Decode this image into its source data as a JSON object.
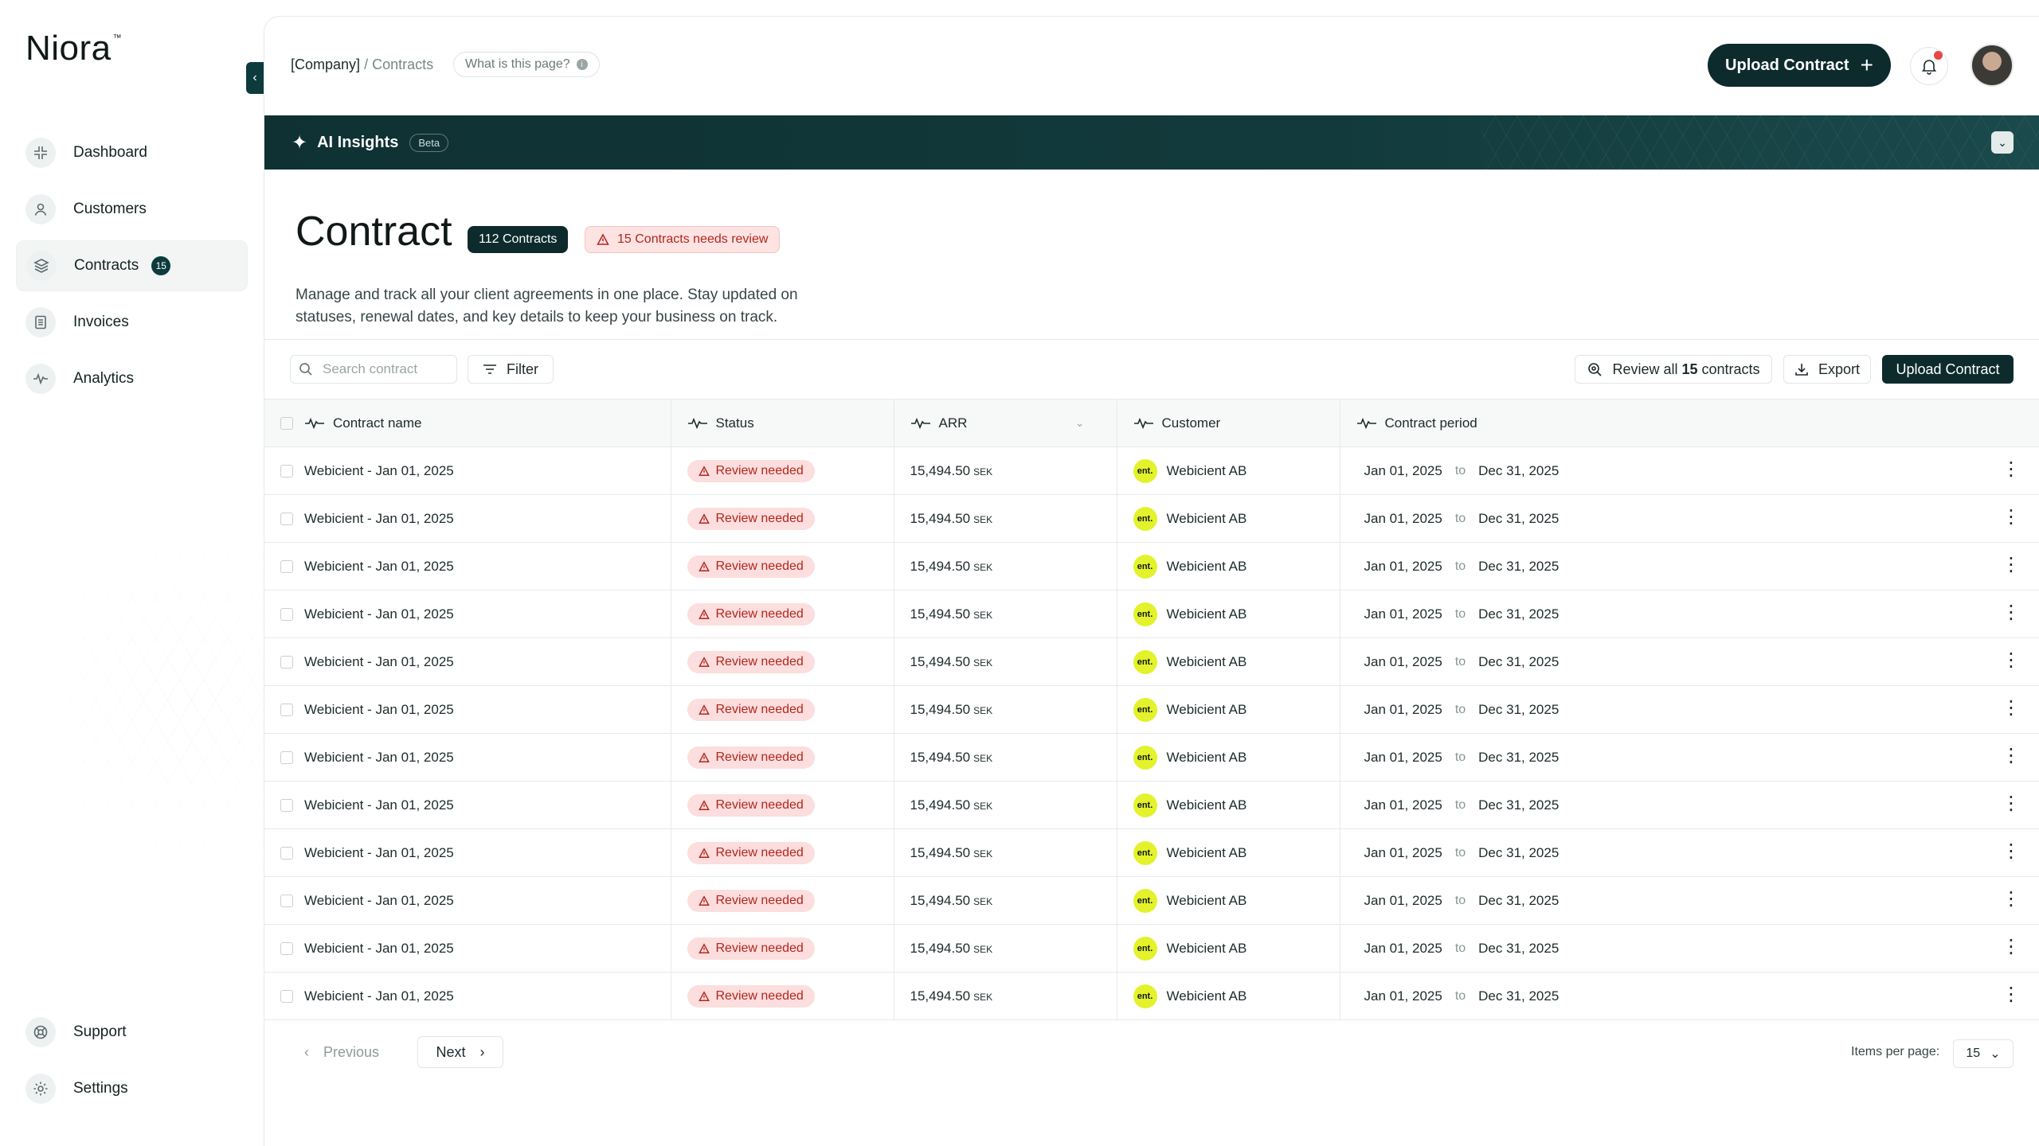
{
  "app": {
    "logo": "Niora",
    "trademark": "™"
  },
  "sidebar": {
    "items": [
      {
        "label": "Dashboard",
        "icon": "dashboard-icon"
      },
      {
        "label": "Customers",
        "icon": "user-icon"
      },
      {
        "label": "Contracts",
        "icon": "layers-icon",
        "badge": "15",
        "active": true
      },
      {
        "label": "Invoices",
        "icon": "document-icon"
      },
      {
        "label": "Analytics",
        "icon": "pulse-icon"
      }
    ],
    "bottom": [
      {
        "label": "Support",
        "icon": "lifebuoy-icon"
      },
      {
        "label": "Settings",
        "icon": "gear-icon"
      }
    ]
  },
  "header": {
    "breadcrumb_company": "[Company]",
    "breadcrumb_sep": "/",
    "breadcrumb_current": "Contracts",
    "help": "What is this page?",
    "help_icon": "i",
    "upload_button": "Upload Contract",
    "notification_color": "#e74848"
  },
  "ai_insights": {
    "title": "AI Insights",
    "beta": "Beta"
  },
  "page": {
    "title": "Contract",
    "count_chip": "112 Contracts",
    "review_chip": "15 Contracts needs review",
    "description": "Manage and track all your client agreements in one place. Stay updated on statuses, renewal dates, and key details to keep your business on track."
  },
  "toolbar": {
    "search_placeholder": "Search contract",
    "filter": "Filter",
    "review_all_prefix": "Review all ",
    "review_all_count": "15",
    "review_all_suffix": " contracts",
    "export": "Export",
    "upload": "Upload Contract"
  },
  "table": {
    "columns": {
      "name": "Contract name",
      "status": "Status",
      "arr": "ARR",
      "customer": "Customer",
      "period": "Contract period"
    },
    "rows": [
      {
        "name": "Webicient - Jan 01, 2025",
        "status": "Review needed",
        "arr": "15,494.50",
        "currency": "SEK",
        "logo": "ent.",
        "customer": "Webicient AB",
        "start": "Jan 01, 2025",
        "to": "to",
        "end": "Dec 31, 2025"
      },
      {
        "name": "Webicient - Jan 01, 2025",
        "status": "Review needed",
        "arr": "15,494.50",
        "currency": "SEK",
        "logo": "ent.",
        "customer": "Webicient AB",
        "start": "Jan 01, 2025",
        "to": "to",
        "end": "Dec 31, 2025"
      },
      {
        "name": "Webicient - Jan 01, 2025",
        "status": "Review needed",
        "arr": "15,494.50",
        "currency": "SEK",
        "logo": "ent.",
        "customer": "Webicient AB",
        "start": "Jan 01, 2025",
        "to": "to",
        "end": "Dec 31, 2025"
      },
      {
        "name": "Webicient - Jan 01, 2025",
        "status": "Review needed",
        "arr": "15,494.50",
        "currency": "SEK",
        "logo": "ent.",
        "customer": "Webicient AB",
        "start": "Jan 01, 2025",
        "to": "to",
        "end": "Dec 31, 2025"
      },
      {
        "name": "Webicient - Jan 01, 2025",
        "status": "Review needed",
        "arr": "15,494.50",
        "currency": "SEK",
        "logo": "ent.",
        "customer": "Webicient AB",
        "start": "Jan 01, 2025",
        "to": "to",
        "end": "Dec 31, 2025"
      },
      {
        "name": "Webicient - Jan 01, 2025",
        "status": "Review needed",
        "arr": "15,494.50",
        "currency": "SEK",
        "logo": "ent.",
        "customer": "Webicient AB",
        "start": "Jan 01, 2025",
        "to": "to",
        "end": "Dec 31, 2025"
      },
      {
        "name": "Webicient - Jan 01, 2025",
        "status": "Review needed",
        "arr": "15,494.50",
        "currency": "SEK",
        "logo": "ent.",
        "customer": "Webicient AB",
        "start": "Jan 01, 2025",
        "to": "to",
        "end": "Dec 31, 2025"
      },
      {
        "name": "Webicient - Jan 01, 2025",
        "status": "Review needed",
        "arr": "15,494.50",
        "currency": "SEK",
        "logo": "ent.",
        "customer": "Webicient AB",
        "start": "Jan 01, 2025",
        "to": "to",
        "end": "Dec 31, 2025"
      },
      {
        "name": "Webicient - Jan 01, 2025",
        "status": "Review needed",
        "arr": "15,494.50",
        "currency": "SEK",
        "logo": "ent.",
        "customer": "Webicient AB",
        "start": "Jan 01, 2025",
        "to": "to",
        "end": "Dec 31, 2025"
      },
      {
        "name": "Webicient - Jan 01, 2025",
        "status": "Review needed",
        "arr": "15,494.50",
        "currency": "SEK",
        "logo": "ent.",
        "customer": "Webicient AB",
        "start": "Jan 01, 2025",
        "to": "to",
        "end": "Dec 31, 2025"
      },
      {
        "name": "Webicient - Jan 01, 2025",
        "status": "Review needed",
        "arr": "15,494.50",
        "currency": "SEK",
        "logo": "ent.",
        "customer": "Webicient AB",
        "start": "Jan 01, 2025",
        "to": "to",
        "end": "Dec 31, 2025"
      },
      {
        "name": "Webicient - Jan 01, 2025",
        "status": "Review needed",
        "arr": "15,494.50",
        "currency": "SEK",
        "logo": "ent.",
        "customer": "Webicient AB",
        "start": "Jan 01, 2025",
        "to": "to",
        "end": "Dec 31, 2025"
      }
    ]
  },
  "pagination": {
    "previous": "Previous",
    "next": "Next",
    "per_page_label": "Items per page:",
    "per_page_value": "15"
  },
  "colors": {
    "brand_dark": "#0d2b2d",
    "status_red": "#b3261e",
    "status_bg": "#fbdedd",
    "customer_logo": "#e3f22a"
  }
}
